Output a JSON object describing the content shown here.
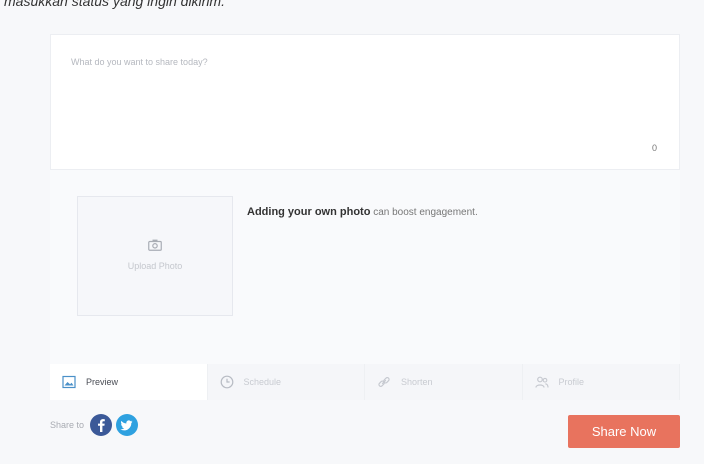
{
  "caption": "masukkan status yang ingin dikirim.",
  "composer": {
    "placeholder": "What do you want to share today?",
    "char_count": "0"
  },
  "photo": {
    "upload_label": "Upload Photo",
    "tip_bold": "Adding your own photo",
    "tip_rest": " can boost engagement."
  },
  "tabs": [
    {
      "label": "Preview",
      "icon": "image-icon",
      "active": true
    },
    {
      "label": "Schedule",
      "icon": "clock-icon",
      "active": false
    },
    {
      "label": "Shorten",
      "icon": "link-icon",
      "active": false
    },
    {
      "label": "Profile",
      "icon": "users-icon",
      "active": false
    }
  ],
  "share": {
    "label": "Share to",
    "networks": [
      "facebook-icon",
      "twitter-icon"
    ],
    "button_label": "Share Now"
  },
  "colors": {
    "accent": "#e8735e",
    "facebook": "#3b5998",
    "twitter": "#2ea1e0",
    "background": "#f7f8fa"
  }
}
